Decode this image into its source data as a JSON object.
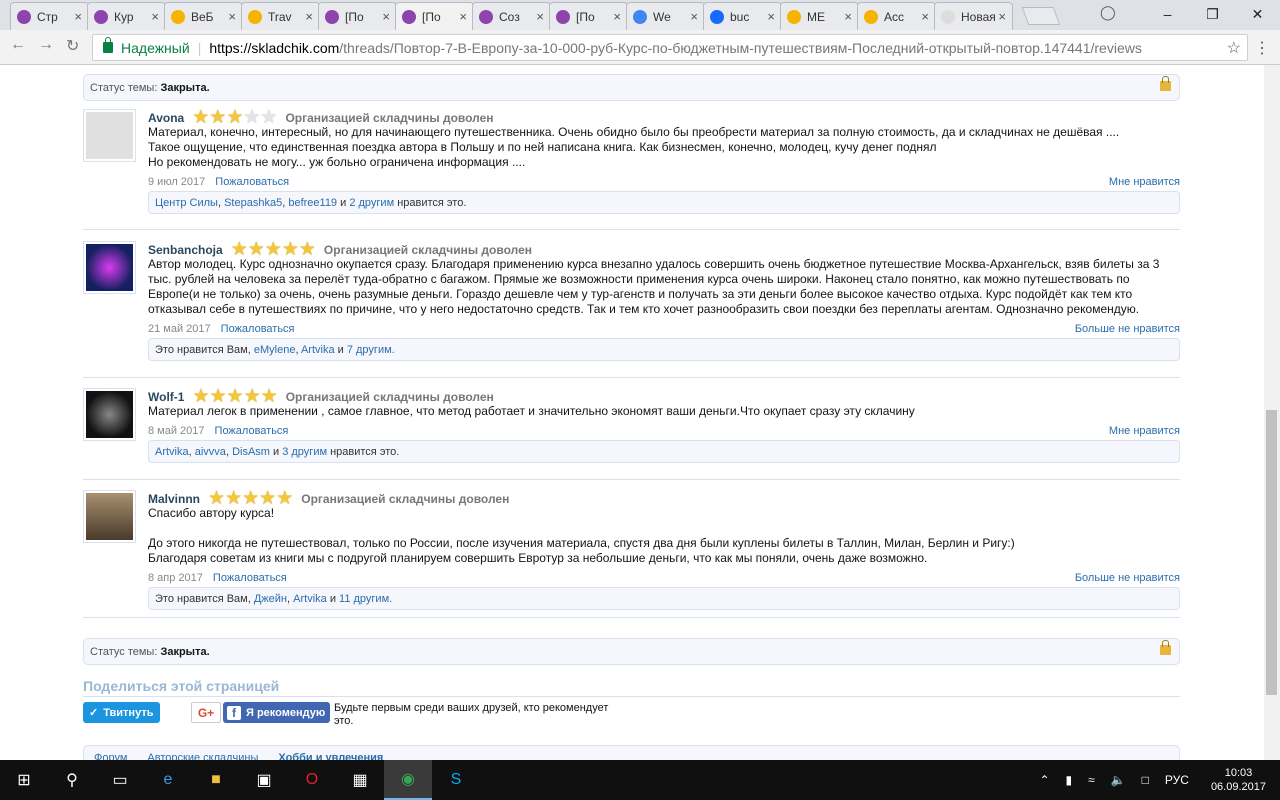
{
  "browser": {
    "tabs": [
      {
        "title": "Стр",
        "color": "#8e44ad",
        "active": false
      },
      {
        "title": "Кур",
        "color": "#8e44ad",
        "active": false
      },
      {
        "title": "ВеБ",
        "color": "#f4b400",
        "active": false
      },
      {
        "title": "Trav",
        "color": "#f4b400",
        "active": false
      },
      {
        "title": "[По",
        "color": "#8e44ad",
        "active": false
      },
      {
        "title": "[По",
        "color": "#8e44ad",
        "active": true
      },
      {
        "title": "Coз",
        "color": "#8e44ad",
        "active": false
      },
      {
        "title": "[По",
        "color": "#8e44ad",
        "active": false
      },
      {
        "title": "We",
        "color": "#4285f4",
        "active": false
      },
      {
        "title": "buc",
        "color": "#1769ff",
        "active": false
      },
      {
        "title": "ME",
        "color": "#f4b400",
        "active": false
      },
      {
        "title": "Acc",
        "color": "#f4b400",
        "active": false
      },
      {
        "title": "Новая",
        "color": "#dddddd",
        "active": false
      }
    ],
    "secure_label": "Надежный",
    "url_host": "https://skladchik.com",
    "url_path": "/threads/Повтор-7-В-Европу-за-10-000-руб-Курс-по-бюджетным-путешествиям-Последний-открытый-повтор.147441/reviews"
  },
  "thread": {
    "status_label": "Статус темы:",
    "status_value": "Закрыта."
  },
  "reviews": [
    {
      "user": "Avona",
      "rating": 3,
      "satisfied": "Организацией складчины доволен",
      "lines": [
        "Материал, конечно, интересный, но для начинающего путешественника. Очень обидно было бы преобрести материал за полную стоимость, да и складчинах не дешёвая ....",
        "Такое ощущение, что единственная поездка автора в Польшу и по ней написана книга. Как бизнесмен, конечно, молодец, кучу денег поднял",
        "Но рекомендовать не могу... уж больно ограничена информация ...."
      ],
      "date": "9 июл 2017",
      "report": "Пожаловаться",
      "like_action": "Мне нравится",
      "likes_names": [
        "Центр Силы",
        "Stepashka5",
        "befree119"
      ],
      "likes_tail_link": "2 другим",
      "likes_prefix": "",
      "likes_suffix": "нравится это."
    },
    {
      "user": "Senbanchoja",
      "rating": 5,
      "satisfied": "Организацией складчины доволен",
      "lines": [
        "Автор молодец. Курс однозначно окупается сразу. Благодаря применению курса внезапно удалось совершить очень бюджетное путешествие Москва-Архангельск, взяв билеты за 3",
        "тыс. рублей на человека за перелёт туда-обратно с багажом. Прямые же возможности применения курса очень широки. Наконец стало понятно, как можно путешествовать по",
        "Европе(и не только) за очень, очень разумные деньги. Гораздо дешевле чем у тур-агенств и получать за эти деньги более высокое качество отдыха. Курс подойдёт как тем кто",
        "отказывал себе в путешествиях по причине, что у него недостаточно средств. Так и тем кто хочет разнообразить свои поездки без переплаты агентам. Однозначно рекомендую."
      ],
      "date": "21 май 2017",
      "report": "Пожаловаться",
      "like_action": "Больше не нравится",
      "likes_prefix": "Это нравится Вам,",
      "likes_names": [
        "eMylene",
        "Artvika"
      ],
      "likes_tail_link": "7 другим.",
      "likes_suffix": ""
    },
    {
      "user": "Wolf-1",
      "rating": 5,
      "satisfied": "Организацией складчины доволен",
      "lines": [
        "Материал легок в применении , самое главное, что метод работает и значительно экономят ваши деньги.Что окупает сразу эту склачину"
      ],
      "date": "8 май 2017",
      "report": "Пожаловаться",
      "like_action": "Мне нравится",
      "likes_prefix": "",
      "likes_names": [
        "Artvika",
        "aivvva",
        "DisAsm"
      ],
      "likes_tail_link": "3 другим",
      "likes_suffix": "нравится это."
    },
    {
      "user": "Malvinnn",
      "rating": 5,
      "satisfied": "Организацией складчины доволен",
      "lines": [
        "Спасибо автору курса!",
        "",
        "До этого никогда не путешествовал, только по России, после изучения материала, спустя два дня были куплены билеты в Таллин, Милан, Берлин и Ригу:)",
        "Благодаря советам из книги мы с подругой планируем совершить Евротур за небольшие деньги, что как мы поняли, очень даже возможно."
      ],
      "date": "8 апр 2017",
      "report": "Пожаловаться",
      "like_action": "Больше не нравится",
      "likes_prefix": "Это нравится Вам,",
      "likes_names": [
        "Джейн",
        "Artvika"
      ],
      "likes_tail_link": "11 другим.",
      "likes_suffix": ""
    }
  ],
  "share": {
    "title": "Поделиться этой страницей",
    "tweet": "Твитнуть",
    "gplus": "G+",
    "fb_recommend": "Я рекомендую",
    "fb_text": "Будьте первым среди ваших друзей, кто рекомендует это."
  },
  "breadcrumbs": [
    "Форум",
    "Авторские складчины",
    "Хобби и увлечения"
  ],
  "taskbar": {
    "lang": "РУС",
    "time": "10:03",
    "date": "06.09.2017"
  }
}
